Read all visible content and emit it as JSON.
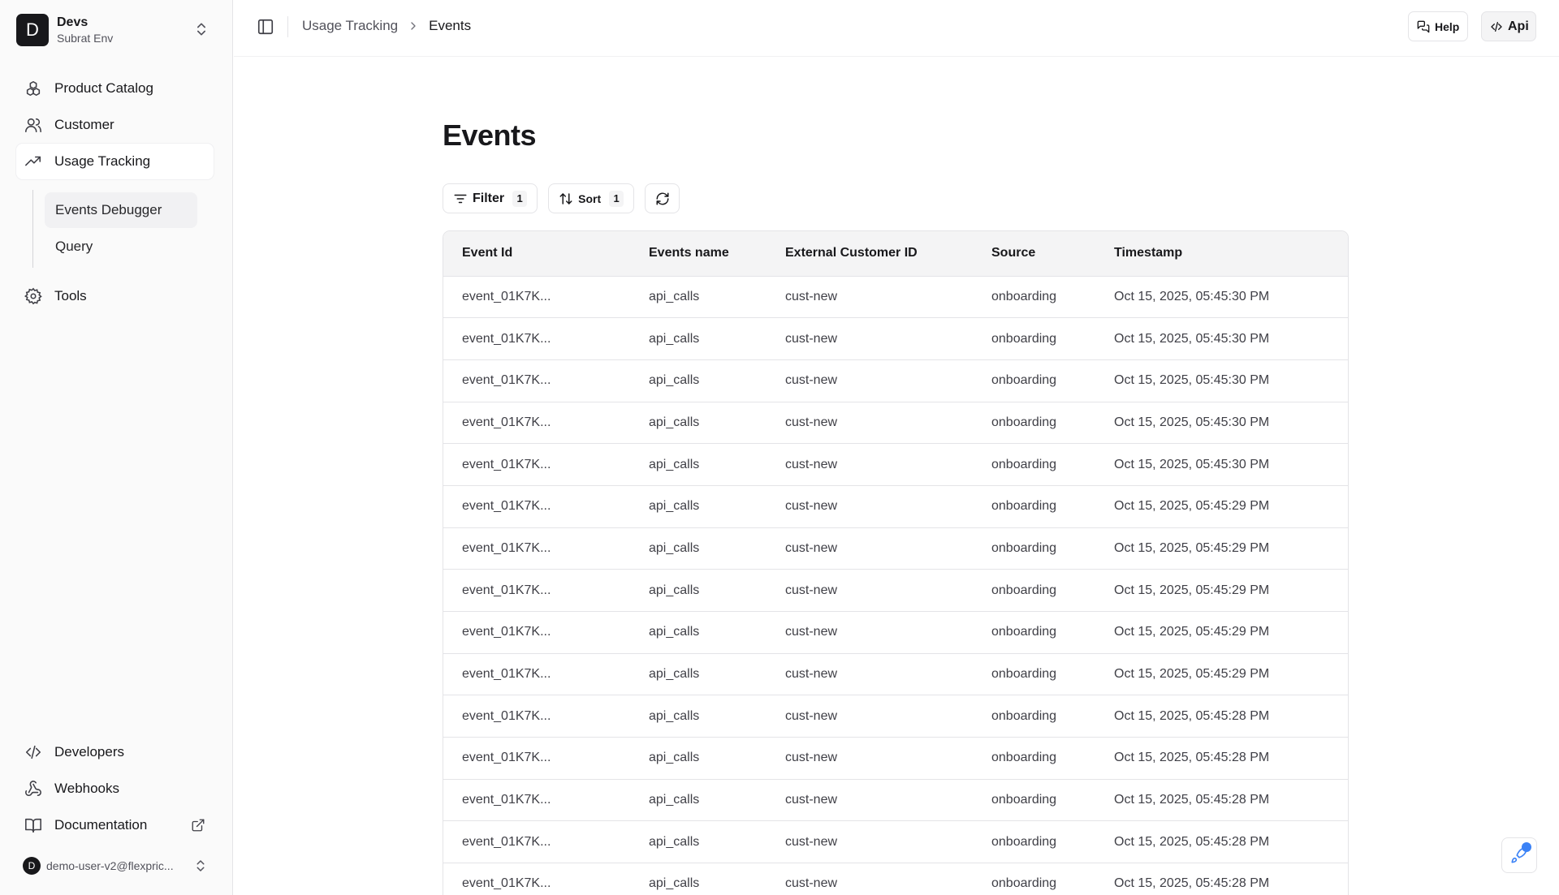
{
  "workspace": {
    "initial": "D",
    "name": "Devs",
    "env": "Subrat Env"
  },
  "nav": {
    "product_catalog": "Product Catalog",
    "customer": "Customer",
    "usage_tracking": "Usage Tracking",
    "sub": {
      "events_debugger": "Events Debugger",
      "query": "Query"
    },
    "tools": "Tools",
    "developers": "Developers",
    "webhooks": "Webhooks",
    "documentation": "Documentation"
  },
  "user": {
    "initial": "D",
    "email": "demo-user-v2@flexpric..."
  },
  "header": {
    "breadcrumb_parent": "Usage Tracking",
    "breadcrumb_current": "Events",
    "help_label": "Help",
    "api_label": "Api"
  },
  "page": {
    "title": "Events"
  },
  "toolbar": {
    "filter_label": "Filter",
    "filter_count": "1",
    "sort_label": "Sort",
    "sort_count": "1"
  },
  "table": {
    "columns": [
      "Event Id",
      "Events name",
      "External Customer ID",
      "Source",
      "Timestamp"
    ],
    "rows": [
      [
        "event_01K7K...",
        "api_calls",
        "cust-new",
        "onboarding",
        "Oct 15, 2025, 05:45:30 PM"
      ],
      [
        "event_01K7K...",
        "api_calls",
        "cust-new",
        "onboarding",
        "Oct 15, 2025, 05:45:30 PM"
      ],
      [
        "event_01K7K...",
        "api_calls",
        "cust-new",
        "onboarding",
        "Oct 15, 2025, 05:45:30 PM"
      ],
      [
        "event_01K7K...",
        "api_calls",
        "cust-new",
        "onboarding",
        "Oct 15, 2025, 05:45:30 PM"
      ],
      [
        "event_01K7K...",
        "api_calls",
        "cust-new",
        "onboarding",
        "Oct 15, 2025, 05:45:30 PM"
      ],
      [
        "event_01K7K...",
        "api_calls",
        "cust-new",
        "onboarding",
        "Oct 15, 2025, 05:45:29 PM"
      ],
      [
        "event_01K7K...",
        "api_calls",
        "cust-new",
        "onboarding",
        "Oct 15, 2025, 05:45:29 PM"
      ],
      [
        "event_01K7K...",
        "api_calls",
        "cust-new",
        "onboarding",
        "Oct 15, 2025, 05:45:29 PM"
      ],
      [
        "event_01K7K...",
        "api_calls",
        "cust-new",
        "onboarding",
        "Oct 15, 2025, 05:45:29 PM"
      ],
      [
        "event_01K7K...",
        "api_calls",
        "cust-new",
        "onboarding",
        "Oct 15, 2025, 05:45:29 PM"
      ],
      [
        "event_01K7K...",
        "api_calls",
        "cust-new",
        "onboarding",
        "Oct 15, 2025, 05:45:28 PM"
      ],
      [
        "event_01K7K...",
        "api_calls",
        "cust-new",
        "onboarding",
        "Oct 15, 2025, 05:45:28 PM"
      ],
      [
        "event_01K7K...",
        "api_calls",
        "cust-new",
        "onboarding",
        "Oct 15, 2025, 05:45:28 PM"
      ],
      [
        "event_01K7K...",
        "api_calls",
        "cust-new",
        "onboarding",
        "Oct 15, 2025, 05:45:28 PM"
      ],
      [
        "event_01K7K...",
        "api_calls",
        "cust-new",
        "onboarding",
        "Oct 15, 2025, 05:45:28 PM"
      ]
    ]
  },
  "colors": {
    "accent_dot": "#3b82f6",
    "text": "#18181b",
    "border": "#e4e4e7"
  }
}
